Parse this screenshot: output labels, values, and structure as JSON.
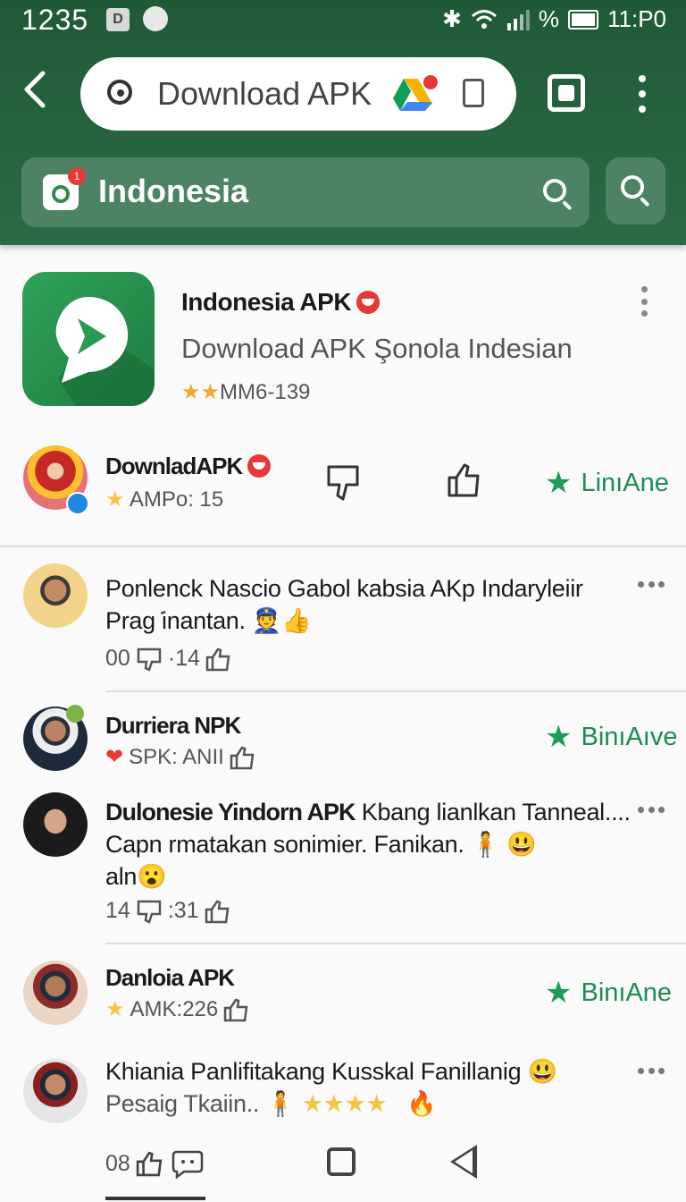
{
  "status_bar": {
    "time": "1235",
    "app_badge": "D",
    "percent": "%",
    "clock": "11:P0"
  },
  "browser": {
    "url_text": "Download APK",
    "drive_badge": "n"
  },
  "search": {
    "country": "Indonesia",
    "cal_badge": "1"
  },
  "app": {
    "name": "Indonesia APK",
    "subtitle": "Download APK Şonola Indesian",
    "rating_text": "MM6-139",
    "stars": 2
  },
  "publisher": {
    "name": "DownladAPK",
    "meta": "AMPo: 15",
    "follow_label": "LinıAne"
  },
  "comments": [
    {
      "text": "Ponlenck Nascio Gabol kabsia AKp  Indaryleiir Prag ̇inantan.",
      "meta_left": "00",
      "meta_right": "·14"
    },
    {
      "author": "Durriera NPK",
      "meta": "SPK: ANII",
      "follow_label": "BinıAıve"
    },
    {
      "author_inline": "Dulonesie Yindorn APK",
      "text": "Kbang lianlkan Tanneal.... Capn rmatakan sonimier. Fanikan.",
      "text_tail": "aln",
      "meta_left": "14",
      "meta_right": ":31"
    },
    {
      "author": "Danloia APK",
      "meta": "AMK:226",
      "follow_label": "BinıAne"
    },
    {
      "text": "Khiania Panlifitakang Kusskal Fanillanig",
      "text_line2": "Pesaig Tkaiin..",
      "meta_left": "08"
    }
  ],
  "colors": {
    "header": "#245f3c",
    "accent": "#1e8a56",
    "star": "#f0a830"
  }
}
